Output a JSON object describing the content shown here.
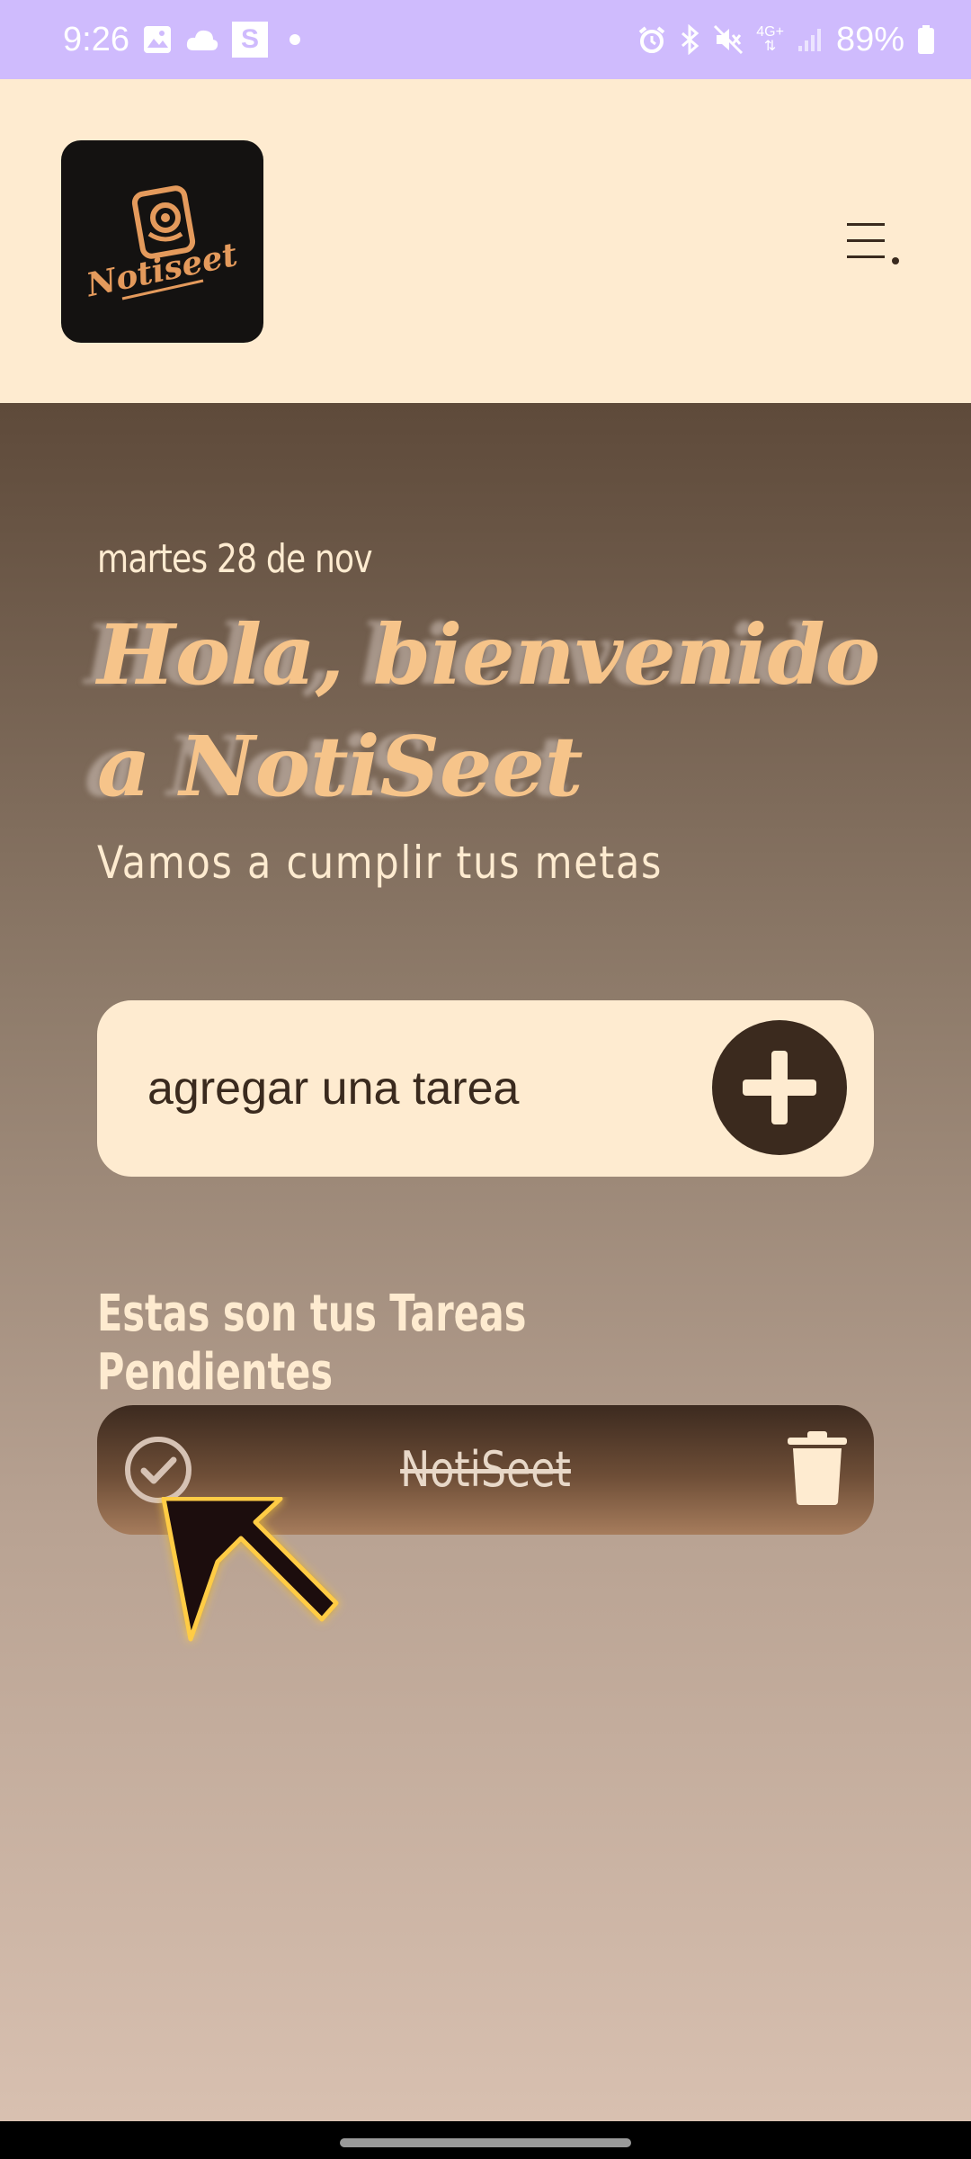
{
  "status_bar": {
    "time": "9:26",
    "s_label": "S",
    "battery": "89%",
    "network": "4G+",
    "icons": [
      "gallery-icon",
      "cloud-icon",
      "s-app-icon",
      "alarm-icon",
      "bluetooth-icon",
      "mute-icon",
      "signal-icon",
      "battery-icon"
    ]
  },
  "header": {
    "logo_text": "Notiseet",
    "menu_icon": "hamburger-menu-icon"
  },
  "main": {
    "date": "martes 28 de nov",
    "welcome_title": "Hola, bienvenido a NotiSeet",
    "subtitle": "Vamos a cumplir tus metas",
    "task_input_placeholder": "agregar una tarea",
    "add_icon": "plus-icon",
    "section_title": "Estas son tus Tareas Pendientes",
    "tasks": [
      {
        "label": "NotiSeet",
        "completed": true
      }
    ]
  },
  "colors": {
    "status_bar_bg": "#cfbbfd",
    "header_bg": "#feebd0",
    "accent": "#f6c48a",
    "dark_brown": "#3b2a1e"
  }
}
